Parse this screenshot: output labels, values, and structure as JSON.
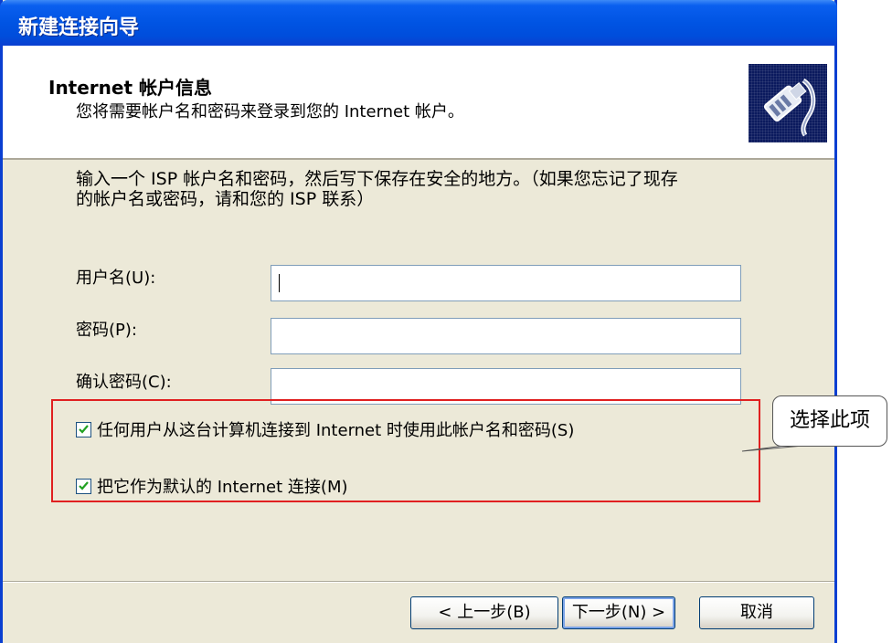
{
  "window": {
    "title": "新建连接向导"
  },
  "header": {
    "title": "Internet 帐户信息",
    "subtitle": "您将需要帐户名和密码来登录到您的 Internet 帐户。",
    "icon": "network-cable-icon"
  },
  "instructions": {
    "line1": "输入一个 ISP 帐户名和密码，然后写下保存在安全的地方。（如果您忘记了现存",
    "line2": "的帐户名或密码，请和您的 ISP 联系）"
  },
  "form": {
    "username": {
      "label": "用户名(U):",
      "value": ""
    },
    "password": {
      "label": "密码(P):",
      "value": ""
    },
    "confirm": {
      "label": "确认密码(C):",
      "value": ""
    }
  },
  "options": {
    "any_user": {
      "label": "任何用户从这台计算机连接到 Internet 时使用此帐户名和密码(S)",
      "checked": true
    },
    "default_connection": {
      "label": "把它作为默认的 Internet 连接(M)",
      "checked": true
    }
  },
  "buttons": {
    "back": "< 上一步(B)",
    "next": "下一步(N) >",
    "cancel": "取消"
  },
  "annotation": {
    "callout_text": "选择此项",
    "highlight_color": "#e02020"
  },
  "colors": {
    "titlebar": "#0054e3",
    "dialog_bg": "#ece9d8"
  }
}
